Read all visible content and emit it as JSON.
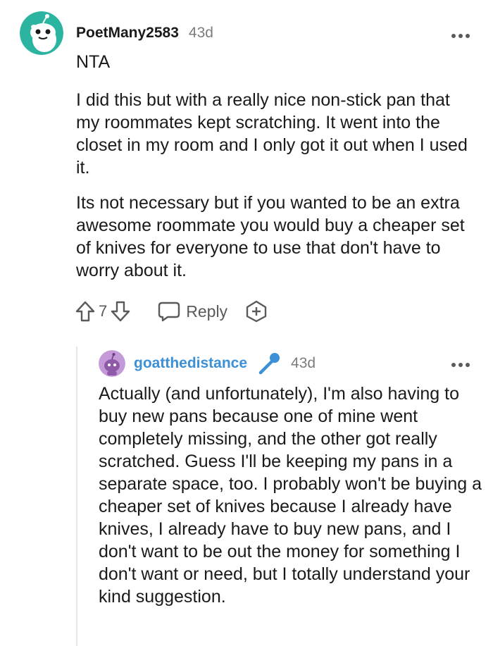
{
  "comment": {
    "username": "PoetMany2583",
    "age": "43d",
    "verdict": "NTA",
    "paragraphs": [
      "I did this but with a really nice non-stick pan that my roommates kept scratching. It went into the closet in my room and I only got it out when I used it.",
      "Its not necessary but if you wanted to be an extra awesome roommate you would buy a cheaper set of knives for everyone to use that don't have to worry about it."
    ],
    "vote_count": "7",
    "reply_label": "Reply",
    "avatar_icon": "snoo-avatar-teal",
    "more_icon": "more-options-icon"
  },
  "reply": {
    "username": "goatthedistance",
    "age": "43d",
    "flair_icon": "microphone-icon",
    "avatar_icon": "snoo-avatar-purple",
    "body": "Actually (and unfortunately), I'm also having to buy new pans because one of mine went completely missing, and the other got really scratched. Guess I'll be keeping my pans in a separate space, too. I probably won't be buying a cheaper set of knives because I already have knives, I already have to buy new pans, and I don't want to be out the money for something I don't want or need, but I totally understand your kind suggestion."
  },
  "colors": {
    "username_reply": "#3c90d6",
    "avatar_teal": "#2bb5a0",
    "avatar_purple": "#c49ad8",
    "icon_gray": "#5a5a5a",
    "thread_line": "#e6e6e6"
  }
}
